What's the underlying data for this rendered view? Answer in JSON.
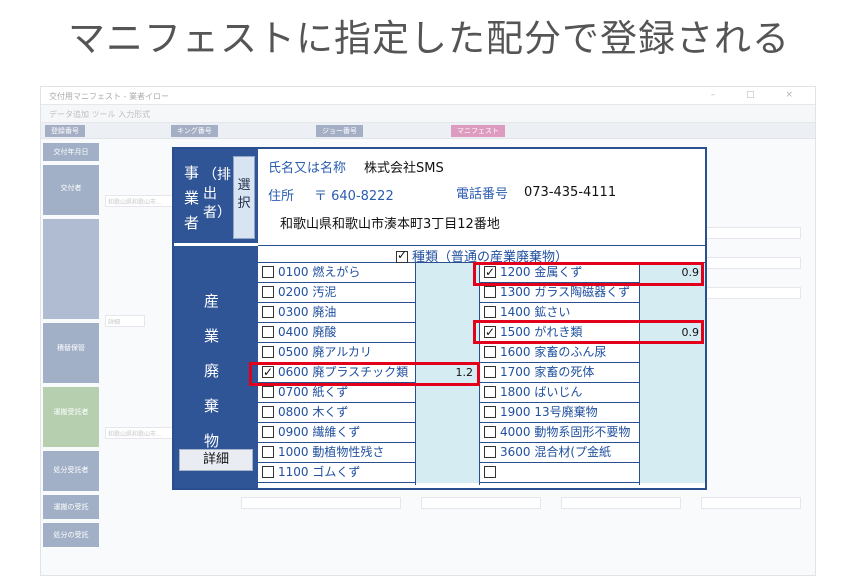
{
  "headline": "マニフェストに指定した配分で登録される",
  "background_window": {
    "title": "交付用マニフェスト - 業者イロー",
    "toolbar": "データ追加   ツール  入力形式",
    "window_controls": [
      "–",
      "□",
      "×"
    ],
    "tabs": [
      "登録番号",
      "キング番号",
      "ジョー番号",
      "マニフェスト"
    ],
    "side_labels": [
      "交付年月日",
      "交付者",
      "運搬受託者",
      "処分受託者",
      "積替保管",
      "運搬の受託",
      "処分の受託"
    ],
    "addr": "和歌山県和歌山市...",
    "detail": "詳細"
  },
  "popup": {
    "jigyosha": "事業者",
    "haishutsu": "（排出者）",
    "select_button": "選択",
    "sangyo": "産業廃棄物",
    "detail_button": "詳細",
    "name_label": "氏名又は名称",
    "name_value": "株式会社SMS",
    "address_label": "住所",
    "postal": "〒 640-8222",
    "phone_label": "電話番号",
    "phone_value": "073-435-4111",
    "address_value": "和歌山県和歌山市湊本町3丁目12番地",
    "category_header": "種類（普通の産業廃棄物）",
    "left_items": [
      {
        "label": "0100 燃えがら",
        "checked": false,
        "qty": ""
      },
      {
        "label": "0200 汚泥",
        "checked": false,
        "qty": ""
      },
      {
        "label": "0300 廃油",
        "checked": false,
        "qty": ""
      },
      {
        "label": "0400 廃酸",
        "checked": false,
        "qty": ""
      },
      {
        "label": "0500 廃アルカリ",
        "checked": false,
        "qty": ""
      },
      {
        "label": "0600 廃プラスチック類",
        "checked": true,
        "qty": "1.2"
      },
      {
        "label": "0700 紙くず",
        "checked": false,
        "qty": ""
      },
      {
        "label": "0800 木くず",
        "checked": false,
        "qty": ""
      },
      {
        "label": "0900 繊維くず",
        "checked": false,
        "qty": ""
      },
      {
        "label": "1000 動植物性残さ",
        "checked": false,
        "qty": ""
      },
      {
        "label": "1100 ゴムくず",
        "checked": false,
        "qty": ""
      }
    ],
    "right_items": [
      {
        "label": "1200 金属くず",
        "checked": true,
        "qty": "0.9"
      },
      {
        "label": "1300 ガラス陶磁器くず",
        "checked": false,
        "qty": ""
      },
      {
        "label": "1400 鉱さい",
        "checked": false,
        "qty": ""
      },
      {
        "label": "1500 がれき類",
        "checked": true,
        "qty": "0.9"
      },
      {
        "label": "1600 家畜のふん尿",
        "checked": false,
        "qty": ""
      },
      {
        "label": "1700 家畜の死体",
        "checked": false,
        "qty": ""
      },
      {
        "label": "1800 ばいじん",
        "checked": false,
        "qty": ""
      },
      {
        "label": "1900 13号廃棄物",
        "checked": false,
        "qty": ""
      },
      {
        "label": "4000 動物系固形不要物",
        "checked": false,
        "qty": ""
      },
      {
        "label": "3600 混合材(プ金紙",
        "checked": false,
        "qty": ""
      },
      {
        "label": "",
        "checked": false,
        "qty": ""
      }
    ]
  }
}
